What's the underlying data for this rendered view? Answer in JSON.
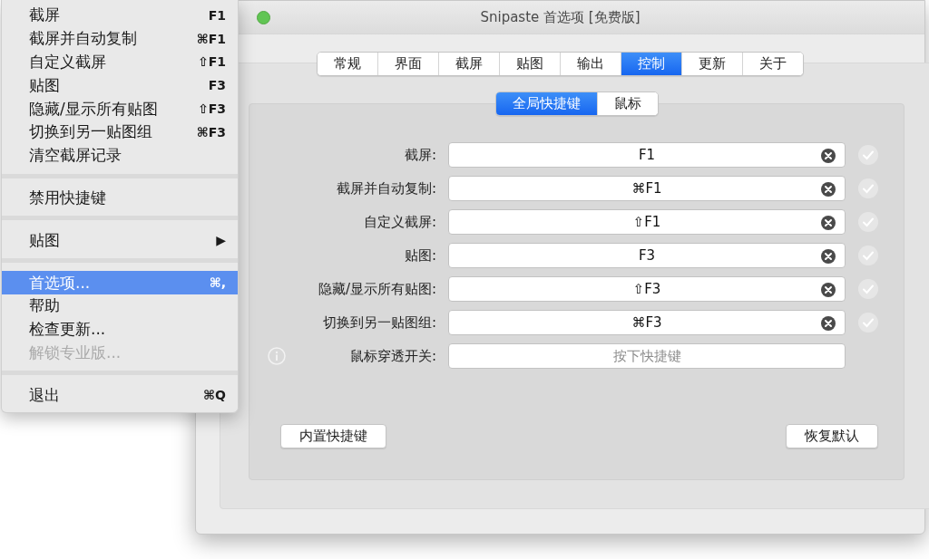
{
  "menu": {
    "items": [
      {
        "kind": "item",
        "label": "截屏",
        "shortcut": "F1",
        "selected": false,
        "disabled": false
      },
      {
        "kind": "item",
        "label": "截屏并自动复制",
        "shortcut": "⌘F1",
        "selected": false,
        "disabled": false
      },
      {
        "kind": "item",
        "label": "自定义截屏",
        "shortcut": "⇧F1",
        "selected": false,
        "disabled": false
      },
      {
        "kind": "item",
        "label": "贴图",
        "shortcut": "F3",
        "selected": false,
        "disabled": false
      },
      {
        "kind": "item",
        "label": "隐藏/显示所有贴图",
        "shortcut": "⇧F3",
        "selected": false,
        "disabled": false
      },
      {
        "kind": "item",
        "label": "切换到另一贴图组",
        "shortcut": "⌘F3",
        "selected": false,
        "disabled": false
      },
      {
        "kind": "item",
        "label": "清空截屏记录",
        "selected": false,
        "disabled": false
      },
      {
        "kind": "separator"
      },
      {
        "kind": "item",
        "label": "禁用快捷键",
        "selected": false,
        "disabled": false
      },
      {
        "kind": "separator"
      },
      {
        "kind": "submenu",
        "label": "贴图",
        "arrow": "▶",
        "selected": false,
        "disabled": false
      },
      {
        "kind": "separator"
      },
      {
        "kind": "item",
        "label": "首选项...",
        "shortcut": "⌘,",
        "selected": true,
        "disabled": false
      },
      {
        "kind": "item",
        "label": "帮助",
        "selected": false,
        "disabled": false
      },
      {
        "kind": "item",
        "label": "检查更新...",
        "selected": false,
        "disabled": false
      },
      {
        "kind": "item",
        "label": "解锁专业版...",
        "selected": false,
        "disabled": true
      },
      {
        "kind": "separator"
      },
      {
        "kind": "item",
        "label": "退出",
        "shortcut": "⌘Q",
        "selected": false,
        "disabled": false
      }
    ]
  },
  "window": {
    "title": "Snipaste 首选项 [免费版]"
  },
  "tabs": [
    {
      "label": "常规",
      "selected": false
    },
    {
      "label": "界面",
      "selected": false
    },
    {
      "label": "截屏",
      "selected": false
    },
    {
      "label": "贴图",
      "selected": false
    },
    {
      "label": "输出",
      "selected": false
    },
    {
      "label": "控制",
      "selected": true
    },
    {
      "label": "更新",
      "selected": false
    },
    {
      "label": "关于",
      "selected": false
    }
  ],
  "subtabs": [
    {
      "label": "全局快捷键",
      "selected": true
    },
    {
      "label": "鼠标",
      "selected": false
    }
  ],
  "shortcuts": [
    {
      "kind": "assigned",
      "label": "截屏:",
      "value": "F1"
    },
    {
      "kind": "assigned",
      "label": "截屏并自动复制:",
      "value": "⌘F1"
    },
    {
      "kind": "assigned",
      "label": "自定义截屏:",
      "value": "⇧F1"
    },
    {
      "kind": "assigned",
      "label": "贴图:",
      "value": "F3"
    },
    {
      "kind": "assigned",
      "label": "隐藏/显示所有贴图:",
      "value": "⇧F3"
    },
    {
      "kind": "assigned",
      "label": "切换到另一贴图组:",
      "value": "⌘F3"
    },
    {
      "kind": "unassigned",
      "label": "鼠标穿透开关:",
      "placeholder": "按下快捷键"
    }
  ],
  "buttons": [
    "内置快捷键",
    "恢复默认"
  ]
}
